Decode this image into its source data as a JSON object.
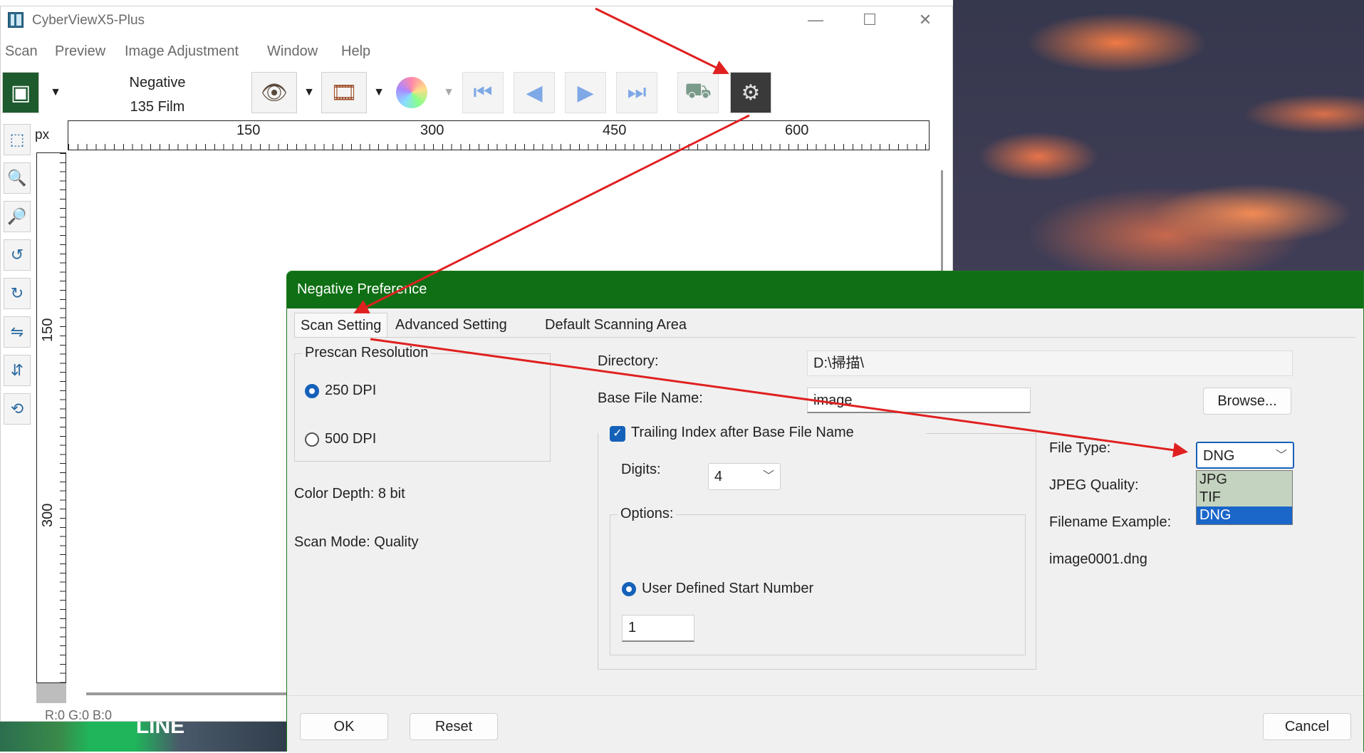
{
  "window": {
    "title": "CyberViewX5-Plus",
    "controls": {
      "minimize": "—",
      "maximize": "☐",
      "close": "✕"
    }
  },
  "menu": [
    "Scan",
    "Preview",
    "Image Adjustment",
    "Window",
    "Help"
  ],
  "toolbar": {
    "film_type_line1": "Negative",
    "film_type_line2": "135 Film",
    "icons": [
      "thumbnail-icon",
      "eye-preview-icon",
      "filmstrip-icon",
      "color-wheel-icon",
      "first-frame-icon",
      "previous-frame-icon",
      "next-frame-icon",
      "last-frame-icon",
      "scanner-icon",
      "preferences-gear-icon"
    ]
  },
  "ruler": {
    "unit": "px",
    "top_labels": [
      "150",
      "300",
      "450",
      "600"
    ],
    "left_labels": [
      "150",
      "300"
    ]
  },
  "status": {
    "rgb": "R:0 G:0 B:0"
  },
  "taskbar": {
    "line_label": "LINE"
  },
  "dialog": {
    "title": "Negative Preference",
    "tabs": [
      "Scan Setting",
      "Advanced Setting",
      "Default Scanning Area"
    ],
    "prescan": {
      "label": "Prescan Resolution",
      "option1": "250 DPI",
      "option2": "500 DPI"
    },
    "color_depth": "Color Depth: 8 bit",
    "scan_mode": "Scan Mode: Quality",
    "directory_label": "Directory:",
    "directory_value": "D:\\掃描\\",
    "base_file_label": "Base File Name:",
    "base_file_value": "image",
    "browse_label": "Browse...",
    "trailing_label": "Trailing Index after Base File Name",
    "digits_label": "Digits:",
    "digits_value": "4",
    "options_label": "Options:",
    "user_defined_label": "User Defined Start Number",
    "start_number": "1",
    "file_type_label": "File Type:",
    "file_type_value": "DNG",
    "file_type_options": [
      "JPG",
      "TIF",
      "DNG"
    ],
    "jpeg_quality_label": "JPEG Quality:",
    "filename_example_label": "Filename Example:",
    "filename_example_value": "image0001.dng",
    "ok_label": "OK",
    "reset_label": "Reset",
    "cancel_label": "Cancel"
  },
  "colors": {
    "dialog_title_bg": "#0f6f14",
    "accent_blue": "#1561b9",
    "arrow_red": "#e02020"
  }
}
